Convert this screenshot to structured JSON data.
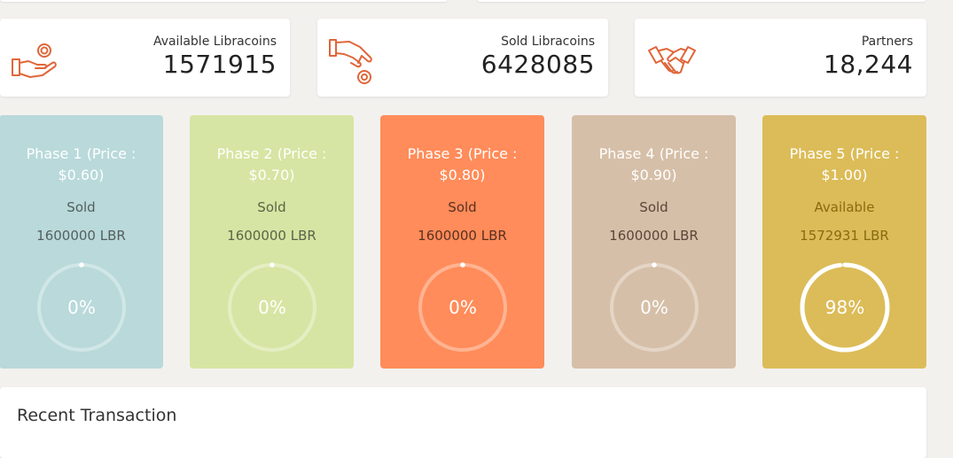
{
  "colors": {
    "page_bg": "#f3f1ee",
    "icon_orange": "#e0663a",
    "phase1_bg": "#b9d9da",
    "phase2_bg": "#d6e5a3",
    "phase3_bg": "#ff8c5a",
    "phase4_bg": "#d6bfa8",
    "phase5_bg": "#dcbc58"
  },
  "stats": [
    {
      "label": "Available Libracoins",
      "value": "1571915",
      "icon": "hand-coin-icon"
    },
    {
      "label": "Sold Libracoins",
      "value": "6428085",
      "icon": "hand-drop-coin-icon"
    },
    {
      "label": "Partners",
      "value": "18,244",
      "icon": "handshake-icon"
    }
  ],
  "phases": [
    {
      "title": "Phase 1 (Price : $0.60)",
      "status": "Sold",
      "amount": "1600000 LBR",
      "percent_text": "0%",
      "progress": 0.0
    },
    {
      "title": "Phase 2 (Price : $0.70)",
      "status": "Sold",
      "amount": "1600000 LBR",
      "percent_text": "0%",
      "progress": 0.0
    },
    {
      "title": "Phase 3 (Price : $0.80)",
      "status": "Sold",
      "amount": "1600000 LBR",
      "percent_text": "0%",
      "progress": 0.0
    },
    {
      "title": "Phase 4 (Price : $0.90)",
      "status": "Sold",
      "amount": "1600000 LBR",
      "percent_text": "0%",
      "progress": 0.0
    },
    {
      "title": "Phase 5 (Price : $1.00)",
      "status": "Available",
      "amount": "1572931 LBR",
      "percent_text": "98%",
      "progress": 0.98
    }
  ],
  "recent": {
    "title": "Recent Transaction"
  }
}
